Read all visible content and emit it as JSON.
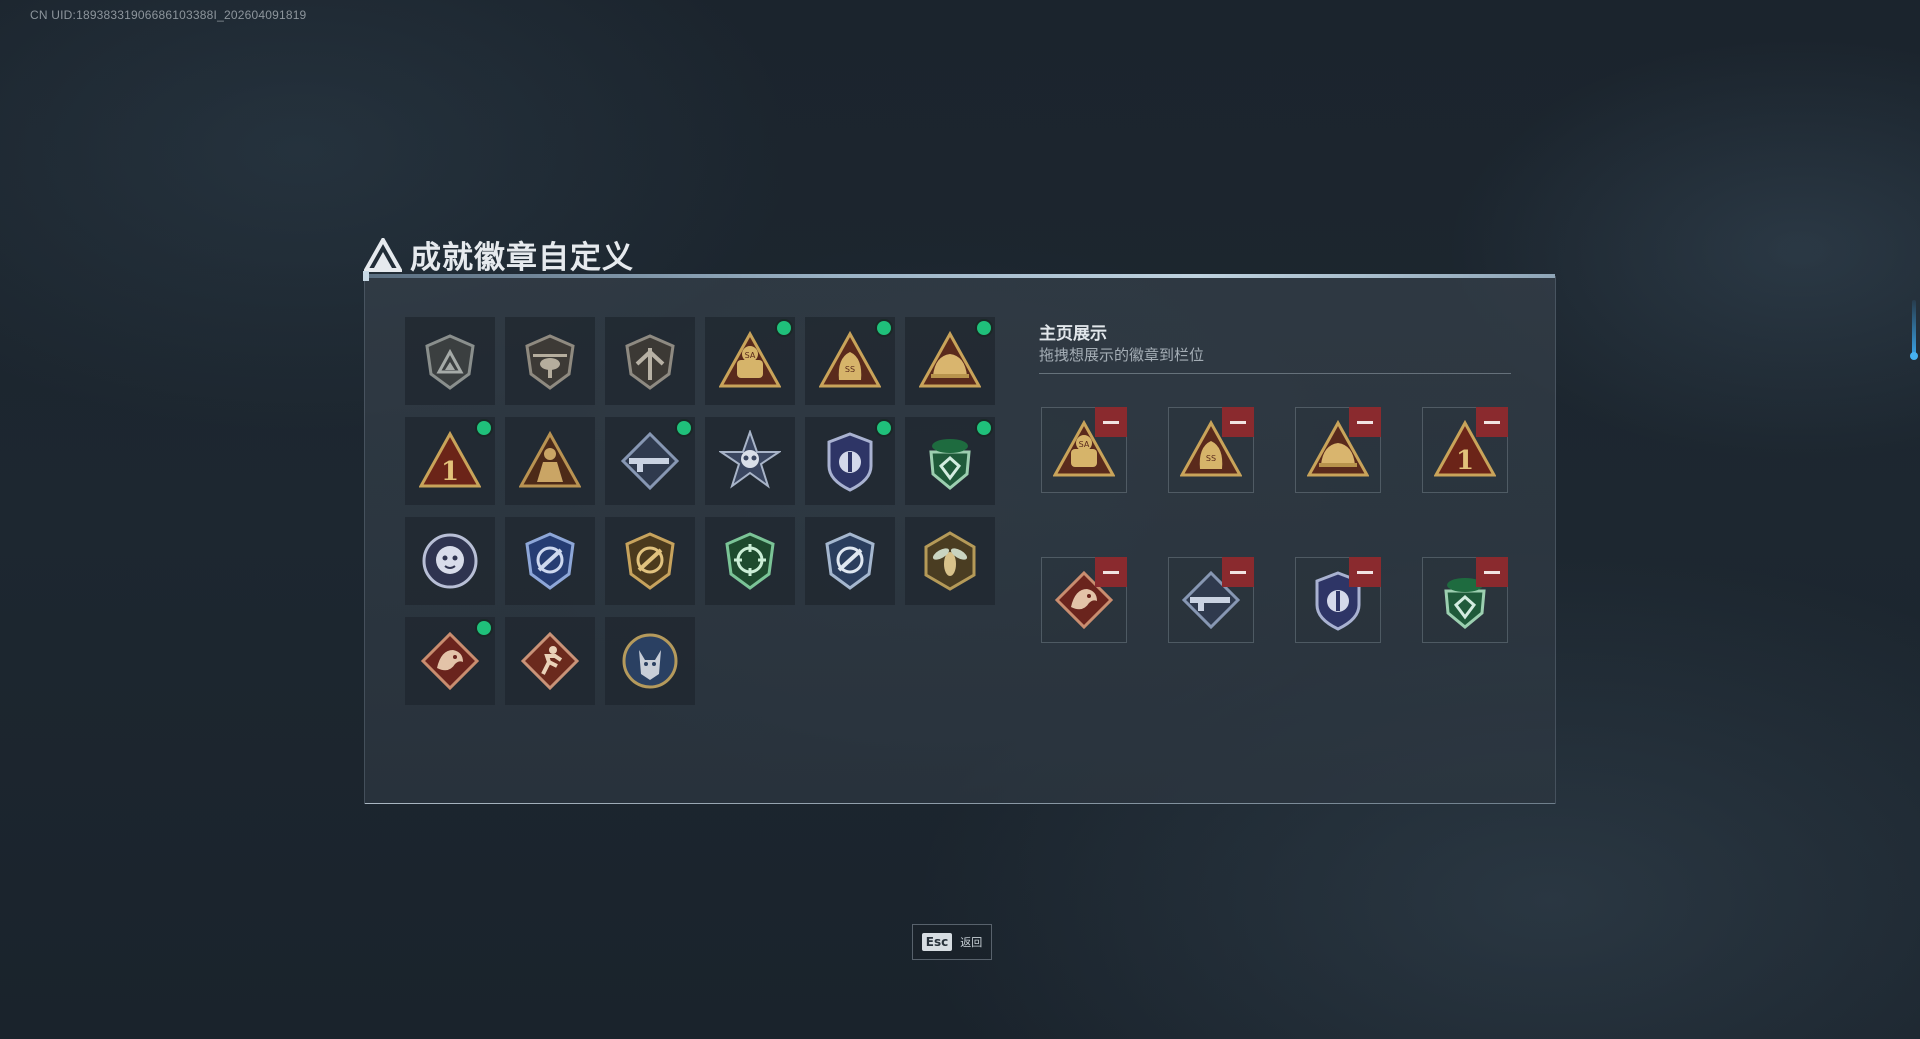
{
  "uid_text": "CN UID:18938331906686103388I_202604091819",
  "page_title": "成就徽章自定义",
  "showcase": {
    "title": "主页展示",
    "subtitle": "拖拽想展示的徽章到栏位"
  },
  "badges": [
    {
      "icon": "shield-triangle-emblem-icon",
      "new": false
    },
    {
      "icon": "shield-helicopter-emblem-icon",
      "new": false
    },
    {
      "icon": "shield-winged-emblem-icon",
      "new": false
    },
    {
      "icon": "sa-bag-triangle-badge-icon",
      "new": true
    },
    {
      "icon": "ss-bag-triangle-badge-icon",
      "new": true
    },
    {
      "icon": "helmet-triangle-badge-icon",
      "new": true
    },
    {
      "icon": "number-one-triangle-badge-icon",
      "new": true
    },
    {
      "icon": "soldier-triangle-badge-icon",
      "new": false
    },
    {
      "icon": "rifle-diamond-badge-icon",
      "new": true
    },
    {
      "icon": "skull-star-badge-icon",
      "new": false
    },
    {
      "icon": "police-crest-badge-icon",
      "new": true
    },
    {
      "icon": "beret-shield-badge-icon",
      "new": true
    },
    {
      "icon": "tiger-head-badge-icon",
      "new": false
    },
    {
      "icon": "crosshair-blue-shield-icon",
      "new": false
    },
    {
      "icon": "crosshair-gold-shield-icon",
      "new": false
    },
    {
      "icon": "crosshair-green-shield-icon",
      "new": false
    },
    {
      "icon": "crosshair-silver-shield-icon",
      "new": false
    },
    {
      "icon": "wasp-hexagon-badge-icon",
      "new": false
    },
    {
      "icon": "dragon-diamond-badge-icon",
      "new": true
    },
    {
      "icon": "runner-diamond-badge-icon",
      "new": false
    },
    {
      "icon": "wolf-circle-badge-icon",
      "new": false
    }
  ],
  "showcase_slots": [
    {
      "icon": "sa-bag-triangle-badge-icon"
    },
    {
      "icon": "ss-bag-triangle-badge-icon"
    },
    {
      "icon": "helmet-triangle-badge-icon"
    },
    {
      "icon": "number-one-triangle-badge-icon"
    },
    {
      "icon": "dragon-diamond-badge-icon"
    },
    {
      "icon": "rifle-diamond-badge-icon"
    },
    {
      "icon": "police-crest-badge-icon"
    },
    {
      "icon": "beret-shield-badge-icon"
    }
  ],
  "footer": {
    "esc_key": "Esc",
    "back_label": "返回"
  },
  "colors": {
    "new_dot": "#1fc07a",
    "remove_button": "#8a2a2e",
    "accent_scroll": "#3aa3e6"
  }
}
